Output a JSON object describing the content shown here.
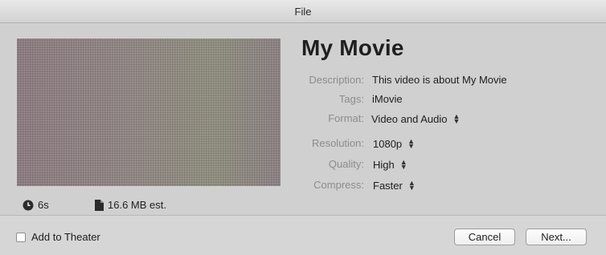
{
  "window": {
    "title": "File"
  },
  "movie": {
    "title": "My Movie",
    "thumbnail_icon": "movie-thumbnail"
  },
  "meta": {
    "duration": "6s",
    "duration_icon": "clock-icon",
    "size": "16.6 MB est.",
    "size_icon": "document-icon"
  },
  "fields": {
    "description": {
      "label": "Description:",
      "value": "This video is about My Movie"
    },
    "tags": {
      "label": "Tags:",
      "value": "iMovie"
    },
    "format": {
      "label": "Format:",
      "value": "Video and Audio"
    },
    "resolution": {
      "label": "Resolution:",
      "value": "1080p"
    },
    "quality": {
      "label": "Quality:",
      "value": "High"
    },
    "compress": {
      "label": "Compress:",
      "value": "Faster"
    }
  },
  "footer": {
    "add_to_theater_label": "Add to Theater",
    "add_to_theater_checked": false,
    "cancel_label": "Cancel",
    "next_label": "Next..."
  },
  "popup_arrows": {
    "up": "▲",
    "down": "▼"
  }
}
